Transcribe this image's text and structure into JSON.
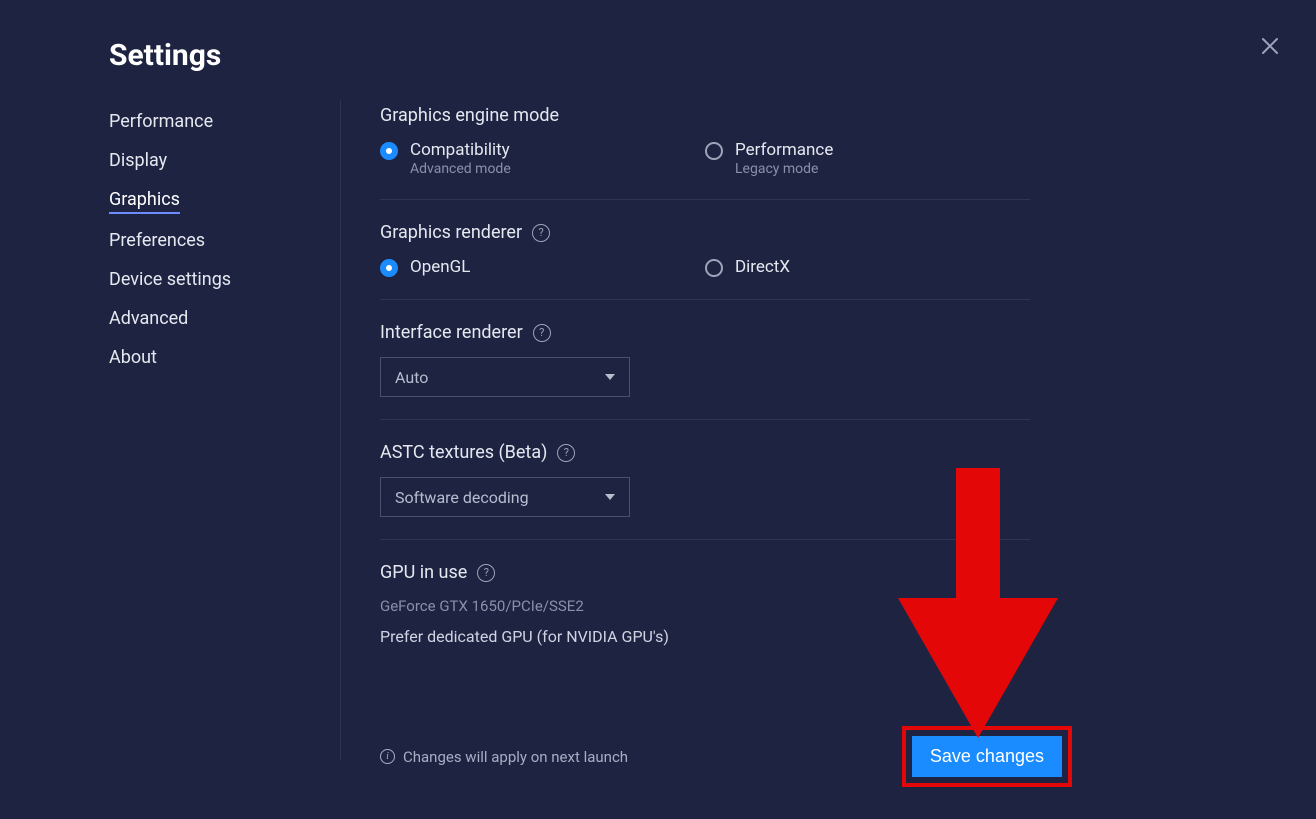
{
  "title": "Settings",
  "sidebar": {
    "items": [
      {
        "label": "Performance",
        "active": false
      },
      {
        "label": "Display",
        "active": false
      },
      {
        "label": "Graphics",
        "active": true
      },
      {
        "label": "Preferences",
        "active": false
      },
      {
        "label": "Device settings",
        "active": false
      },
      {
        "label": "Advanced",
        "active": false
      },
      {
        "label": "About",
        "active": false
      }
    ]
  },
  "graphics": {
    "engine_mode": {
      "title": "Graphics engine mode",
      "options": [
        {
          "label": "Compatibility",
          "sub": "Advanced mode",
          "selected": true
        },
        {
          "label": "Performance",
          "sub": "Legacy mode",
          "selected": false
        }
      ]
    },
    "renderer": {
      "title": "Graphics renderer",
      "options": [
        {
          "label": "OpenGL",
          "selected": true
        },
        {
          "label": "DirectX",
          "selected": false
        }
      ]
    },
    "interface_renderer": {
      "title": "Interface renderer",
      "selected": "Auto"
    },
    "astc": {
      "title": "ASTC textures (Beta)",
      "selected": "Software decoding"
    },
    "gpu": {
      "title": "GPU in use",
      "value": "GeForce GTX 1650/PCIe/SSE2",
      "note": "Prefer dedicated GPU (for NVIDIA GPU's)"
    }
  },
  "footer": {
    "notice": "Changes will apply on next launch",
    "save_label": "Save changes"
  },
  "annotation": {
    "arrow_color": "#e30707",
    "highlight_color": "#e30707"
  }
}
